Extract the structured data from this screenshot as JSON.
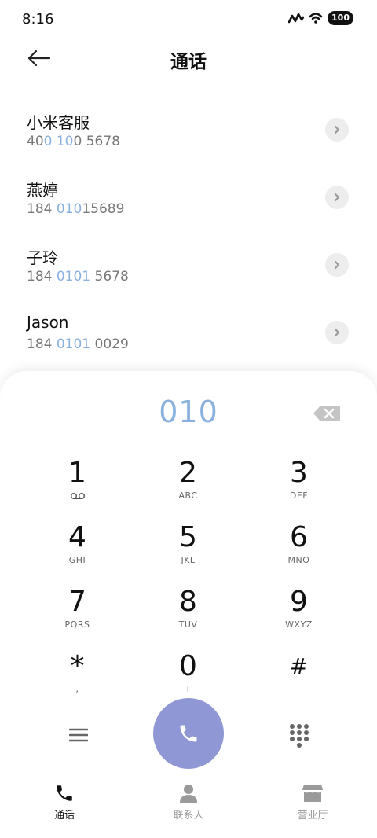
{
  "status_bar": {
    "time": "8:16",
    "battery": "100"
  },
  "header": {
    "title": "通话",
    "back_icon": "arrow-left-icon"
  },
  "contacts": [
    {
      "name": "小米客服",
      "number_parts": [
        "40",
        "0 10",
        "0 5678"
      ]
    },
    {
      "name": "燕婷",
      "number_parts": [
        "184 ",
        "010",
        "15689"
      ]
    },
    {
      "name": "子玲",
      "number_parts": [
        "184 ",
        "0101",
        " 5678"
      ]
    },
    {
      "name": "Jason",
      "number_parts": [
        "184 ",
        "0101",
        " 0029"
      ]
    }
  ],
  "dialer": {
    "input": "010",
    "keys": [
      {
        "digit": "1",
        "letters": ""
      },
      {
        "digit": "2",
        "letters": "ABC"
      },
      {
        "digit": "3",
        "letters": "DEF"
      },
      {
        "digit": "4",
        "letters": "GHI"
      },
      {
        "digit": "5",
        "letters": "JKL"
      },
      {
        "digit": "6",
        "letters": "MNO"
      },
      {
        "digit": "7",
        "letters": "PQRS"
      },
      {
        "digit": "8",
        "letters": "TUV"
      },
      {
        "digit": "9",
        "letters": "WXYZ"
      },
      {
        "digit": "*",
        "letters": ","
      },
      {
        "digit": "0",
        "letters": "+"
      },
      {
        "digit": "#",
        "letters": ""
      }
    ]
  },
  "bottom_nav": [
    {
      "label": "通话",
      "icon": "phone-icon",
      "active": true
    },
    {
      "label": "联系人",
      "icon": "person-icon",
      "active": false
    },
    {
      "label": "营业厅",
      "icon": "store-icon",
      "active": false
    }
  ],
  "colors": {
    "highlight": "#8ab0de",
    "call_button": "#8f97d4",
    "inactive_nav": "#9a9a9a"
  }
}
